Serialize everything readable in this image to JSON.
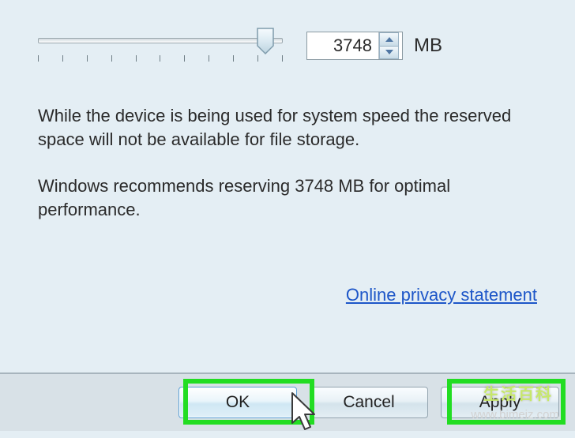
{
  "slider": {
    "value": 3748,
    "unit": "MB"
  },
  "info_text_1": "While the device is being used for system speed the reserved space will not be available for file storage.",
  "info_text_2": "Windows recommends reserving 3748 MB for optimal performance.",
  "link": {
    "privacy": "Online privacy statement"
  },
  "buttons": {
    "ok": "OK",
    "cancel": "Cancel",
    "apply": "Apply"
  },
  "watermark": {
    "logo": "生活百科",
    "url": "www.bimeiz.com"
  }
}
